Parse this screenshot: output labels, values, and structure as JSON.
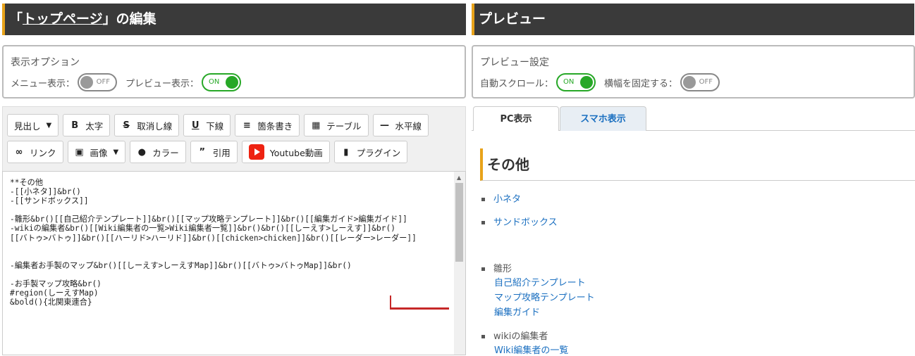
{
  "editor_panel": {
    "title_prefix": "「",
    "title_link": "トップページ",
    "title_suffix": "」の編集",
    "options": {
      "title": "表示オプション",
      "menu_label": "メニュー表示：",
      "menu_state": "OFF",
      "preview_label": "プレビュー表示：",
      "preview_state": "ON"
    },
    "toolbar": {
      "heading": "見出し",
      "bold": "太字",
      "strike": "取消し線",
      "underline": "下線",
      "bullets": "箇条書き",
      "table": "テーブル",
      "hr": "水平線",
      "link": "リンク",
      "image": "画像",
      "color": "カラー",
      "quote": "引用",
      "youtube": "Youtube動画",
      "plugin": "プラグイン"
    },
    "editor_text": "**その他\n-[[小ネタ]]&br()\n-[[サンドボックス]]\n\n-雛形&br()[[自己紹介テンプレート]]&br()[[マップ攻略テンプレート]]&br()[[編集ガイド>編集ガイド]]\n-wikiの編集者&br()[[Wiki編集者の一覧>Wiki編集者一覧]]&br()&br()[[しーえす>しーえす]]&br()\n[[バトゥ>バトゥ]]&br()[[ハーリド>ハーリド]]&br()[[chicken>chicken]]&br()[[レーダー>レーダー]]\n\n\n-編集者お手製のマップ&br()[[しーえす>しーえすMap]]&br()[[バトゥ>バトゥMap]]&br()\n\n-お手製マップ攻略&br()\n#region(しーえすMap)\n&bold(){北関東連合}"
  },
  "preview_panel": {
    "title": "プレビュー",
    "settings": {
      "title": "プレビュー設定",
      "autoscroll_label": "自動スクロール：",
      "autoscroll_state": "ON",
      "fixwidth_label": "横幅を固定する：",
      "fixwidth_state": "OFF"
    },
    "tabs": {
      "pc": "PC表示",
      "sp": "スマホ表示"
    },
    "content": {
      "heading": "その他",
      "items": {
        "koneta": "小ネタ",
        "sandbox": "サンドボックス",
        "hinagata": "雛形",
        "hinagata_links": [
          "自己紹介テンプレート",
          "マップ攻略テンプレート",
          "編集ガイド"
        ],
        "editors": "wikiの編集者",
        "editors_link": "Wiki編集者の一覧"
      }
    }
  }
}
